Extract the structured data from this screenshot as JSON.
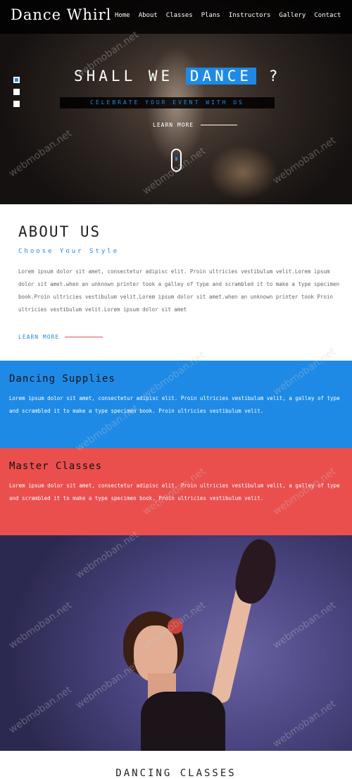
{
  "header": {
    "logo": "Dance Whirl",
    "nav": [
      "Home",
      "About",
      "Classes",
      "Plans",
      "Instructors",
      "Gallery",
      "Contact"
    ]
  },
  "hero": {
    "headline_pre": "SHALL WE",
    "headline_highlight": "DANCE",
    "headline_post": "?",
    "tagline": "CELEBRATE YOUR EVENT WITH US",
    "learn_more": "LEARN MORE",
    "slide_count": 3,
    "active_slide": 1
  },
  "about": {
    "title": "ABOUT US",
    "subtitle": "Choose Your Style",
    "body": "Lorem ipsum dolor sit amet, consectetur adipisc elit. Proin ultricies vestibulum velit.Lorem ipsum dolor sit amet.when an unknown printer took a galley of type and scrambled it to make a type specimen book.Proin ultricies vestibulum velit.Lorem ipsum dolor sit amet.when an unknown printer took Proin ultricies vestibulum velit.Lorem ipsum dolor sit amet",
    "learn_more": "LEARN MORE"
  },
  "supplies": {
    "title": "Dancing Supplies",
    "body": "Lorem ipsum dolor sit amet, consectetur adipisc elit. Proin ultricies vestibulum velit, a galley of type and scrambled it to make a type specimen book. Proin ultricies vestibulum velit."
  },
  "masters": {
    "title": "Master Classes",
    "body": "Lorem ipsum dolor sit amet, consectetur adipisc elit. Proin ultricies vestibulum velit, a galley of type and scrambled it to make a type specimen book. Proin ultricies vestibulum velit."
  },
  "dancing_classes": {
    "title": "DANCING CLASSES"
  },
  "watermark": "webmoban.net",
  "colors": {
    "accent_blue": "#1e8ae6",
    "accent_red": "#ea4f4e",
    "topbar": "#000000"
  }
}
